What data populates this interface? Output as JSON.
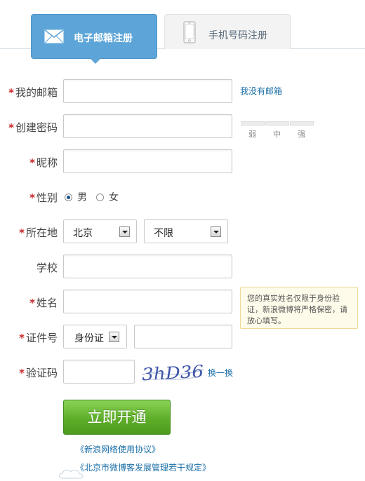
{
  "tabs": {
    "email": {
      "label": "电子邮箱注册"
    },
    "phone": {
      "label": "手机号码注册"
    }
  },
  "required_mark": "*",
  "form": {
    "email": {
      "label": "我的邮箱",
      "value": "",
      "side_link": "我没有邮箱"
    },
    "password": {
      "label": "创建密码",
      "value": "",
      "strength": {
        "weak": "弱",
        "medium": "中",
        "strong": "强",
        "level": 0
      }
    },
    "nickname": {
      "label": "昵称",
      "value": ""
    },
    "gender": {
      "label": "性别",
      "options": [
        "男",
        "女"
      ],
      "selected": "男"
    },
    "location": {
      "label": "所在地",
      "province": "北京",
      "city": "不限"
    },
    "school": {
      "label": "学校",
      "value": ""
    },
    "real_name": {
      "label": "姓名",
      "value": "",
      "tip": "您的真实姓名仅限于身份验证，新浪微博将严格保密，请放心填写。"
    },
    "id_number": {
      "label": "证件号",
      "id_type": "身份证",
      "value": ""
    },
    "captcha": {
      "label": "验证码",
      "value": "",
      "image_text": "3hD36",
      "refresh_link": "换一换"
    }
  },
  "submit": {
    "label": "立即开通"
  },
  "agreements": [
    "《新浪网络使用协议》",
    "《北京市微博客发展管理若干规定》"
  ],
  "colors": {
    "accent": "#5da5d8",
    "required": "#c8282a",
    "link": "#1b6fa6",
    "submit": "#5eae2a"
  }
}
